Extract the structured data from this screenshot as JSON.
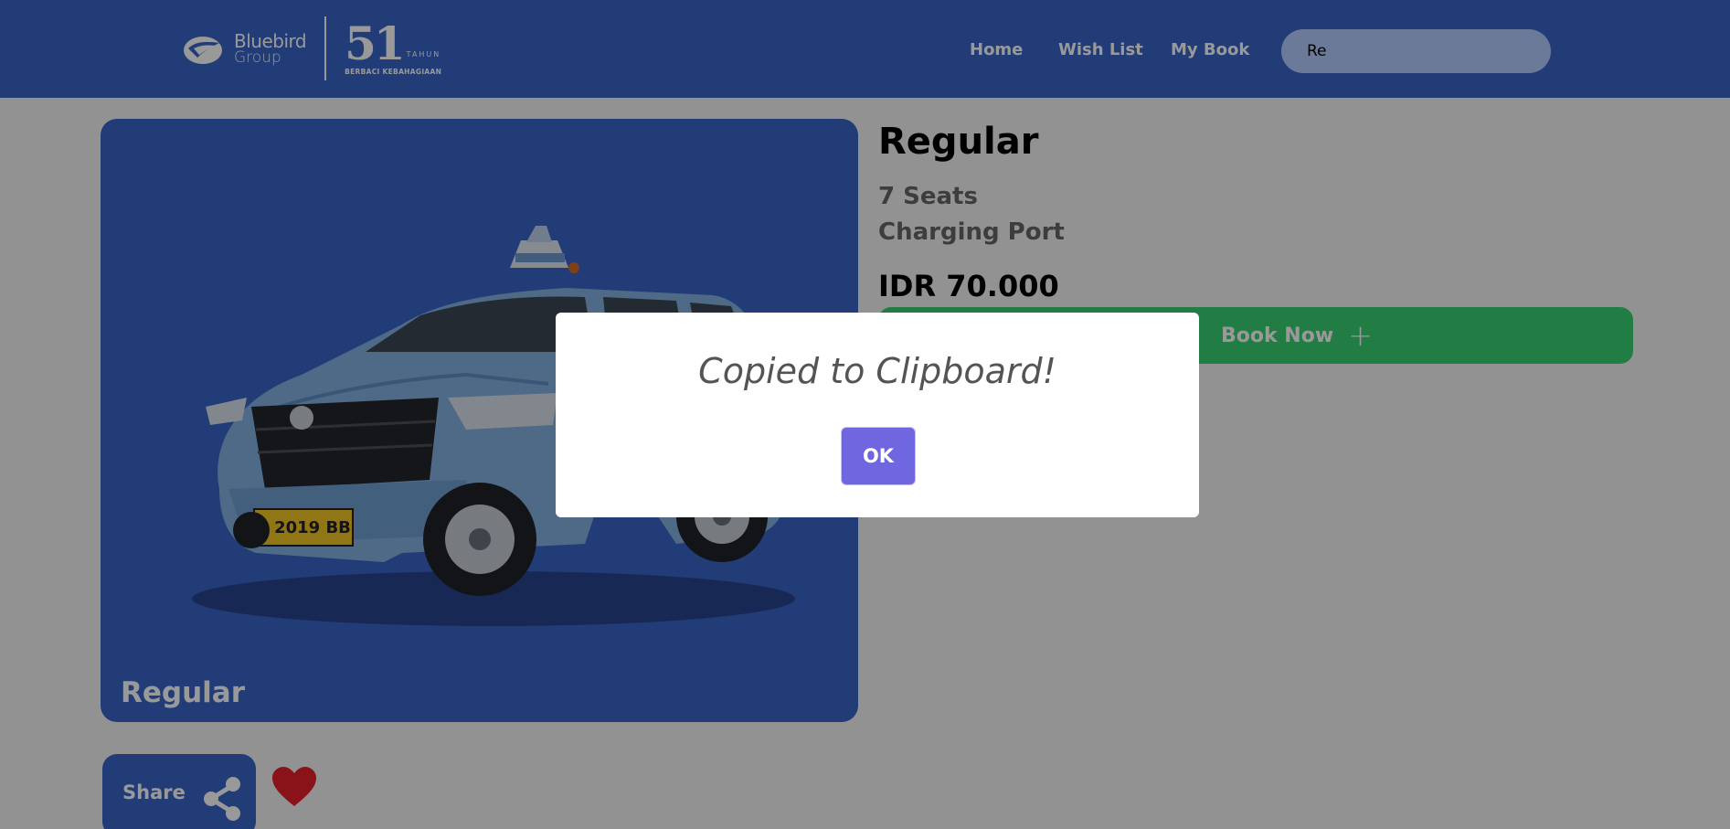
{
  "header": {
    "brand_name": "Bluebird",
    "brand_sub": "Group",
    "anniversary_number": "51",
    "anniversary_word": "TAHUN",
    "anniversary_tagline": "BERBACI KEBAHAGIAAN",
    "nav": [
      {
        "label": "Home"
      },
      {
        "label": "Wish List"
      },
      {
        "label": "My Book"
      }
    ],
    "search": {
      "value": "Re"
    }
  },
  "product": {
    "image_caption": "Regular",
    "title": "Regular",
    "features": [
      "7 Seats",
      "Charging Port"
    ],
    "price": "IDR 70.000",
    "book_label": "Book Now",
    "share_label": "Share"
  },
  "dialog": {
    "title": "Copied to Clipboard!",
    "ok_label": "OK"
  },
  "colors": {
    "header_bg": "#3a64c8",
    "book_button": "#3ad172",
    "ok_button": "#7066e0",
    "heart": "#e4202a"
  }
}
